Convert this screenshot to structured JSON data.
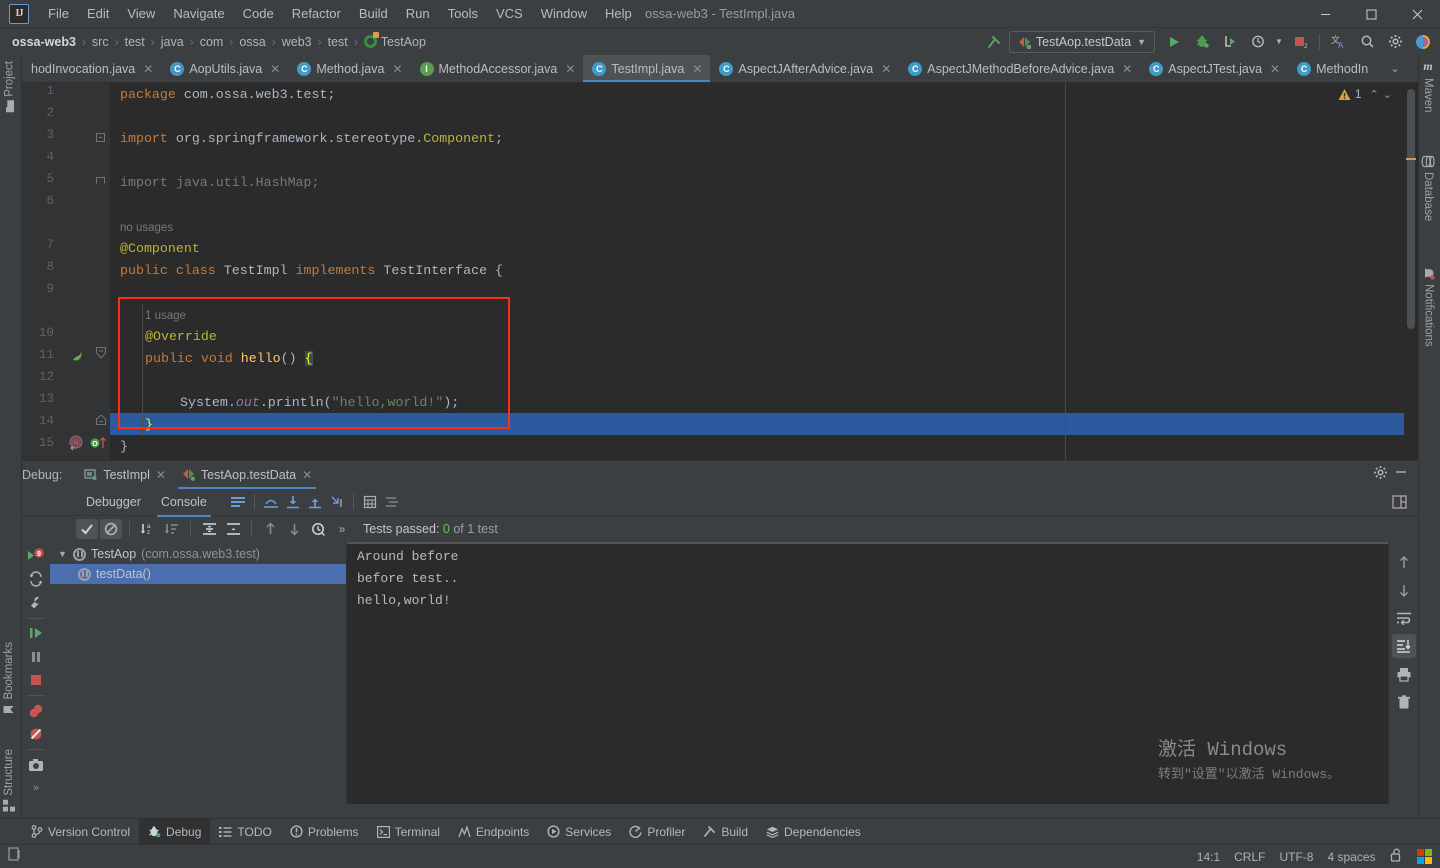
{
  "window": {
    "title": "ossa-web3 - TestImpl.java",
    "logo": "IJ",
    "minimize": "—",
    "maximize": "▢",
    "close": "✕"
  },
  "menu": [
    {
      "label": "File"
    },
    {
      "label": "Edit"
    },
    {
      "label": "View"
    },
    {
      "label": "Navigate"
    },
    {
      "label": "Code"
    },
    {
      "label": "Refactor"
    },
    {
      "label": "Build"
    },
    {
      "label": "Run"
    },
    {
      "label": "Tools"
    },
    {
      "label": "VCS"
    },
    {
      "label": "Window"
    },
    {
      "label": "Help"
    }
  ],
  "navbar": {
    "crumbs": [
      "ossa-web3",
      "src",
      "test",
      "java",
      "com",
      "ossa",
      "web3",
      "test",
      "TestAop"
    ],
    "run_config": "TestAop.testData",
    "icons": [
      "build-hammer-icon",
      "run-icon",
      "debug-icon",
      "run-with-coverage-icon",
      "profiler-icon",
      "stop-icon",
      "translate-icon",
      "search-icon",
      "settings-gear-icon",
      "ide-assistant-icon"
    ]
  },
  "tabs": [
    {
      "label": "hodInvocation.java",
      "kind": "class",
      "active": false
    },
    {
      "label": "AopUtils.java",
      "kind": "class",
      "active": false
    },
    {
      "label": "Method.java",
      "kind": "class",
      "active": false
    },
    {
      "label": "MethodAccessor.java",
      "kind": "interface",
      "active": false
    },
    {
      "label": "TestImpl.java",
      "kind": "class",
      "active": true
    },
    {
      "label": "AspectJAfterAdvice.java",
      "kind": "class",
      "active": false
    },
    {
      "label": "AspectJMethodBeforeAdvice.java",
      "kind": "class",
      "active": false
    },
    {
      "label": "AspectJTest.java",
      "kind": "class",
      "active": false
    },
    {
      "label": "MethodIn",
      "kind": "class",
      "active": false
    }
  ],
  "editor": {
    "warning_count": "1",
    "lines": [
      {
        "num": "1",
        "indent": 0,
        "tokens": [
          {
            "t": "package ",
            "c": "kw"
          },
          {
            "t": "com.ossa.web3.test;",
            "c": "plain"
          }
        ]
      },
      {
        "num": "2",
        "indent": 0,
        "tokens": []
      },
      {
        "num": "3",
        "indent": 0,
        "fold": "minus",
        "tokens": [
          {
            "t": "import ",
            "c": "kw"
          },
          {
            "t": "org.springframework.stereotype.",
            "c": "plain"
          },
          {
            "t": "Component",
            "c": "ann"
          },
          {
            "t": ";",
            "c": "plain"
          }
        ]
      },
      {
        "num": "4",
        "indent": 0,
        "tokens": []
      },
      {
        "num": "5",
        "indent": 0,
        "fold": "collapsed",
        "tokens": [
          {
            "t": "import java.util.HashMap;",
            "c": "dim"
          }
        ]
      },
      {
        "num": "6",
        "indent": 0,
        "tokens": []
      },
      {
        "num": "",
        "indent": 0,
        "tokens": [
          {
            "t": "no usages",
            "c": "hint"
          }
        ]
      },
      {
        "num": "7",
        "indent": 0,
        "tokens": [
          {
            "t": "@Component",
            "c": "ann"
          }
        ]
      },
      {
        "num": "8",
        "indent": 0,
        "tokens": [
          {
            "t": "public class ",
            "c": "kw"
          },
          {
            "t": "TestImpl ",
            "c": "plain"
          },
          {
            "t": "implements ",
            "c": "kw"
          },
          {
            "t": "TestInterface {",
            "c": "plain"
          }
        ]
      },
      {
        "num": "9",
        "indent": 0,
        "tokens": []
      },
      {
        "num": "",
        "indent": 1,
        "tokens": [
          {
            "t": "1 usage",
            "c": "hint"
          }
        ]
      },
      {
        "num": "10",
        "indent": 1,
        "tokens": [
          {
            "t": "@Override",
            "c": "ann"
          }
        ]
      },
      {
        "num": "11",
        "indent": 1,
        "tokens": [
          {
            "t": "public void ",
            "c": "kw"
          },
          {
            "t": "hello",
            "c": "type"
          },
          {
            "t": "() ",
            "c": "plain"
          },
          {
            "t": "{",
            "c": "brace"
          }
        ]
      },
      {
        "num": "12",
        "indent": 1,
        "tokens": []
      },
      {
        "num": "13",
        "indent": 2,
        "tokens": [
          {
            "t": "System.",
            "c": "plain"
          },
          {
            "t": "out",
            "c": "stat"
          },
          {
            "t": ".println(",
            "c": "plain"
          },
          {
            "t": "\"hello,world!\"",
            "c": "str"
          },
          {
            "t": ");",
            "c": "plain"
          }
        ]
      },
      {
        "num": "14",
        "indent": 1,
        "selected": true,
        "tokens": [
          {
            "t": "}",
            "c": "brace"
          }
        ]
      },
      {
        "num": "15",
        "indent": 0,
        "tokens": [
          {
            "t": "}",
            "c": "plain"
          }
        ]
      }
    ]
  },
  "debug": {
    "label": "Debug:",
    "tabs": [
      {
        "label": "TestImpl",
        "icon": "debug-session-icon",
        "active": false
      },
      {
        "label": "TestAop.testData",
        "icon": "test-run-icon",
        "active": true
      }
    ],
    "subtabs": [
      {
        "label": "Debugger",
        "active": false
      },
      {
        "label": "Console",
        "active": true
      }
    ],
    "settings_icon": "gear-icon",
    "collapse_icon": "minimize-icon",
    "layout_icon": "layout-settings-icon",
    "rerun_icon": "rerun-icon",
    "toolbar_icons": [
      "show-passed-icon",
      "hide-ignored-icon",
      "sort-alphabetically-icon",
      "sort-by-duration-icon",
      "expand-all-icon",
      "collapse-all-icon",
      "prev-failed-icon",
      "next-failed-icon",
      "history-icon",
      "more-icon"
    ],
    "tests_status_prefix": "Tests passed: ",
    "tests_passed": "0",
    "tests_status_suffix": " of 1 test",
    "tree": [
      {
        "label": "TestAop",
        "package": "(com.ossa.web3.test)",
        "level": 0,
        "expanded": true,
        "selected": false
      },
      {
        "label": "testData()",
        "package": "",
        "level": 1,
        "expanded": false,
        "selected": true
      }
    ],
    "sidebar_icons": [
      "resume-program-icon",
      "restore-layout-icon",
      "settings-wrench-icon",
      "step-over-icon",
      "pause-icon",
      "stop-icon",
      "view-breakpoints-icon",
      "mute-breakpoints-icon",
      "camera-icon",
      "more-icon"
    ],
    "console_lines": [
      "Around before",
      "before test..",
      "hello,world!"
    ],
    "console_side_icons": [
      "up-arrow-icon",
      "down-arrow-icon",
      "soft-wrap-icon",
      "scroll-to-end-icon",
      "print-icon",
      "trash-icon"
    ]
  },
  "watermark": {
    "line1": "激活 Windows",
    "line2": "转到\"设置\"以激活 Windows。"
  },
  "left_strip": [
    {
      "label": "Project",
      "icon": "folder-icon"
    },
    {
      "label": "Bookmarks",
      "icon": "bookmark-icon"
    },
    {
      "label": "Structure",
      "icon": "structure-icon"
    }
  ],
  "right_strip": [
    {
      "label": "Maven",
      "icon": "maven-icon"
    },
    {
      "label": "Database",
      "icon": "database-icon"
    },
    {
      "label": "Notifications",
      "icon": "notifications-bell-icon"
    }
  ],
  "tool_windows": [
    {
      "label": "Version Control",
      "icon": "branch-icon",
      "active": false
    },
    {
      "label": "Debug",
      "icon": "bug-icon",
      "active": true
    },
    {
      "label": "TODO",
      "icon": "todo-list-icon",
      "active": false
    },
    {
      "label": "Problems",
      "icon": "problems-icon",
      "active": false
    },
    {
      "label": "Terminal",
      "icon": "terminal-icon",
      "active": false
    },
    {
      "label": "Endpoints",
      "icon": "endpoints-icon",
      "active": false
    },
    {
      "label": "Services",
      "icon": "services-icon",
      "active": false
    },
    {
      "label": "Profiler",
      "icon": "profiler-icon",
      "active": false
    },
    {
      "label": "Build",
      "icon": "build-hammer-icon",
      "active": false
    },
    {
      "label": "Dependencies",
      "icon": "dependencies-icon",
      "active": false
    }
  ],
  "status": {
    "left_icon": "memory-indicator-icon",
    "caret": "14:1",
    "line_sep": "CRLF",
    "encoding": "UTF-8",
    "indent": "4 spaces",
    "lock_icon": "unlocked-icon",
    "flag_icon": "windows-flag-icon"
  }
}
